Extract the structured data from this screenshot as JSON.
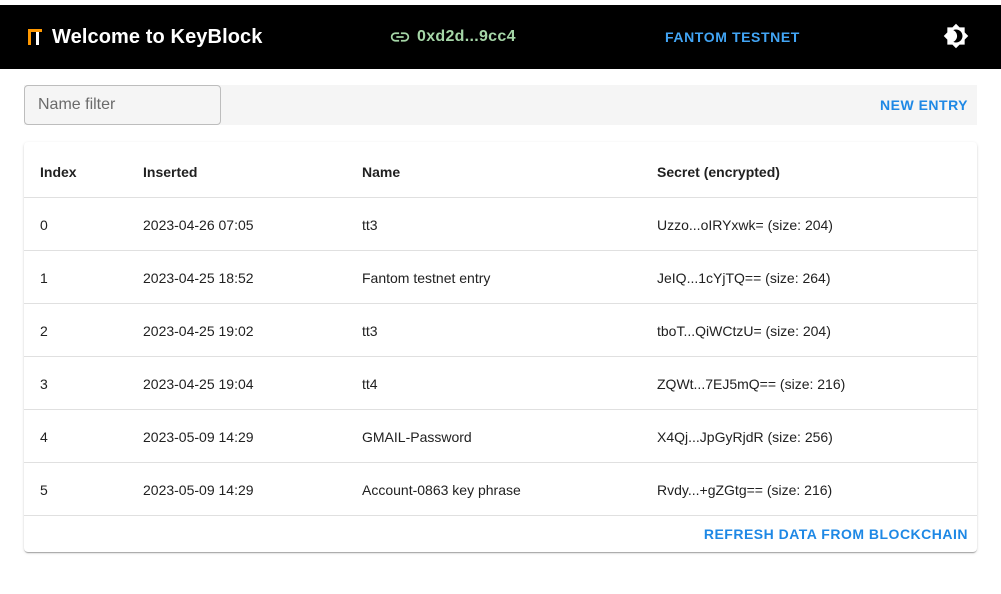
{
  "header": {
    "title": "Welcome to KeyBlock",
    "account": "0xd2d...9cc4",
    "network": "FANTOM TESTNET",
    "logo_icon": "keyblock-logo-icon",
    "account_icon": "link-icon",
    "theme_icon": "brightness-icon"
  },
  "toolbar": {
    "filter_placeholder": "Name filter",
    "filter_value": "",
    "new_entry_label": "NEW ENTRY"
  },
  "table": {
    "columns": [
      "Index",
      "Inserted",
      "Name",
      "Secret (encrypted)"
    ],
    "rows": [
      [
        "0",
        "2023-04-26 07:05",
        "tt3",
        "Uzzo...oIRYxwk= (size: 204)"
      ],
      [
        "1",
        "2023-04-25 18:52",
        "Fantom testnet entry",
        "JeIQ...1cYjTQ== (size: 264)"
      ],
      [
        "2",
        "2023-04-25 19:02",
        "tt3",
        "tboT...QiWCtzU= (size: 204)"
      ],
      [
        "3",
        "2023-04-25 19:04",
        "tt4",
        "ZQWt...7EJ5mQ== (size: 216)"
      ],
      [
        "4",
        "2023-05-09 14:29",
        "GMAIL-Password",
        "X4Qj...JpGyRjdR (size: 256)"
      ],
      [
        "5",
        "2023-05-09 14:29",
        "Account-0863 key phrase",
        "Rvdy...+gZGtg== (size: 216)"
      ]
    ],
    "refresh_label": "REFRESH DATA FROM BLOCKCHAIN"
  },
  "colors": {
    "appbar_bg": "#000000",
    "account_text": "#a5d6a7",
    "network_text": "#42a5f5",
    "action_text": "#1e88e5"
  }
}
